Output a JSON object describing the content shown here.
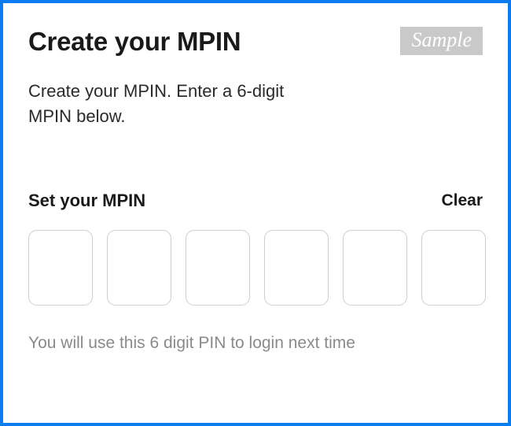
{
  "header": {
    "title": "Create your MPIN",
    "badge": "Sample"
  },
  "description": "Create your MPIN. Enter a 6-digit MPIN below.",
  "section": {
    "label": "Set your MPIN",
    "clear": "Clear"
  },
  "pin": {
    "values": [
      "",
      "",
      "",
      "",
      "",
      ""
    ]
  },
  "footer": "You will use this 6 digit PIN to login next time"
}
